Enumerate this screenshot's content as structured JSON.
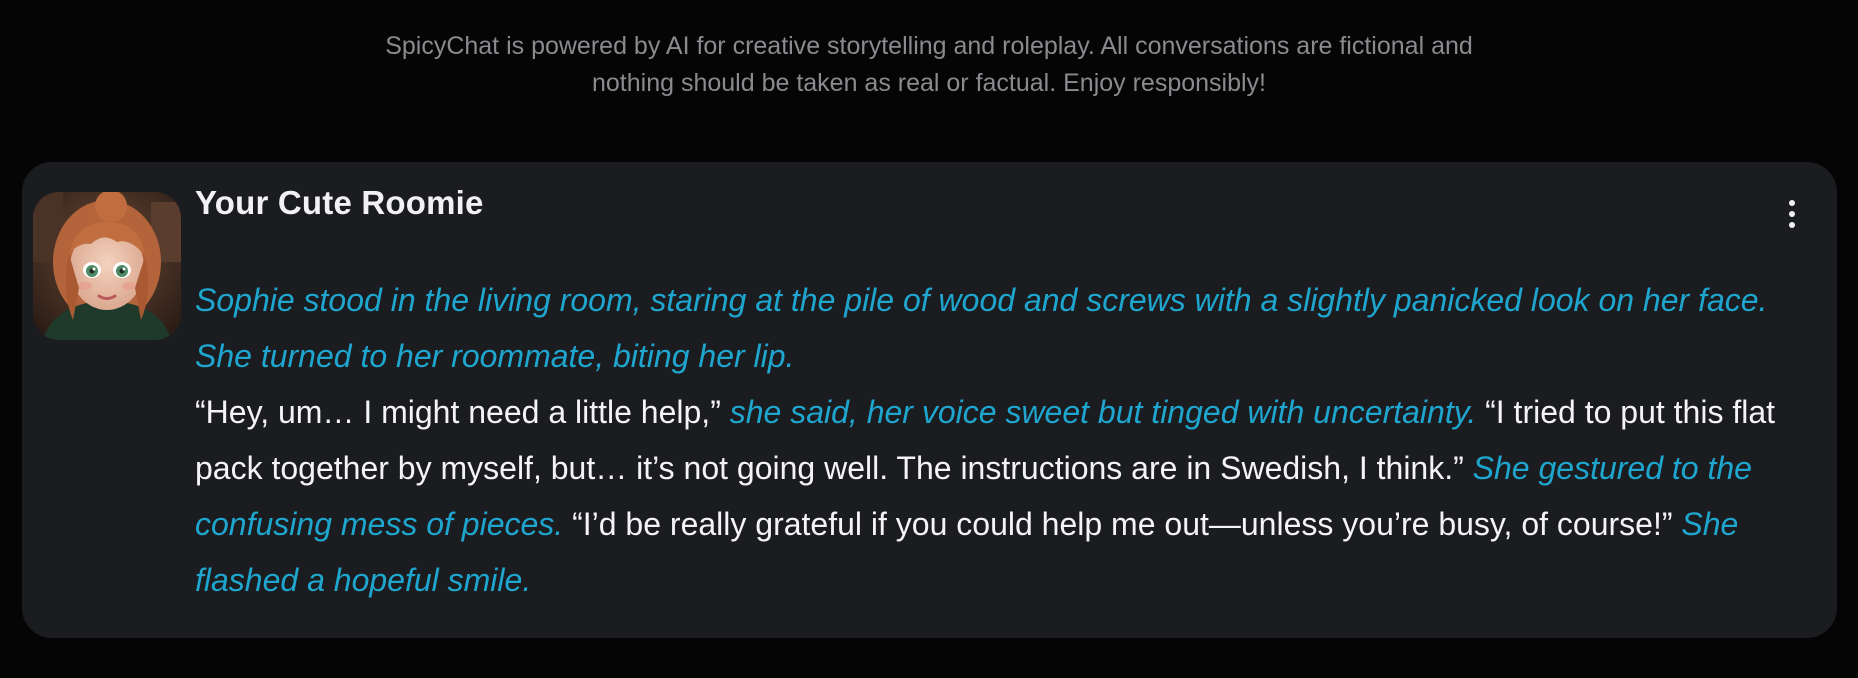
{
  "disclaimer": {
    "line1": "SpicyChat is powered by AI for creative storytelling and roleplay. All conversations are fictional and",
    "line2": "nothing should be taken as real or factual. Enjoy responsibly!"
  },
  "message_card": {
    "character_name": "Your Cute Roomie",
    "menu_icon": "more-vertical-icon",
    "avatar_alt": "Your Cute Roomie avatar",
    "paragraph1": {
      "action": "Sophie stood in the living room, staring at the pile of wood and screws with a slightly panicked look on her face. She turned to her roommate, biting her lip."
    },
    "paragraph2": {
      "seg1": "“Hey, um… I might need a little help,”",
      "seg2": "she said, her voice sweet but tinged with uncertainty.",
      "seg3": "“I tried to put this flat pack together by myself, but… it’s not going well. The instructions are in Swedish, I think.”",
      "seg4": "She gestured to the confusing mess of pieces.",
      "seg5": "“I’d be really grateful if you could help me out—unless you’re busy, of course!”",
      "seg6": "She flashed a hopeful smile."
    }
  },
  "colors": {
    "background": "#050506",
    "card": "#1b1c1f",
    "action_text": "#1ea6cf",
    "dialogue_text": "#f4f4f6",
    "disclaimer_text": "#8a8a8f"
  }
}
